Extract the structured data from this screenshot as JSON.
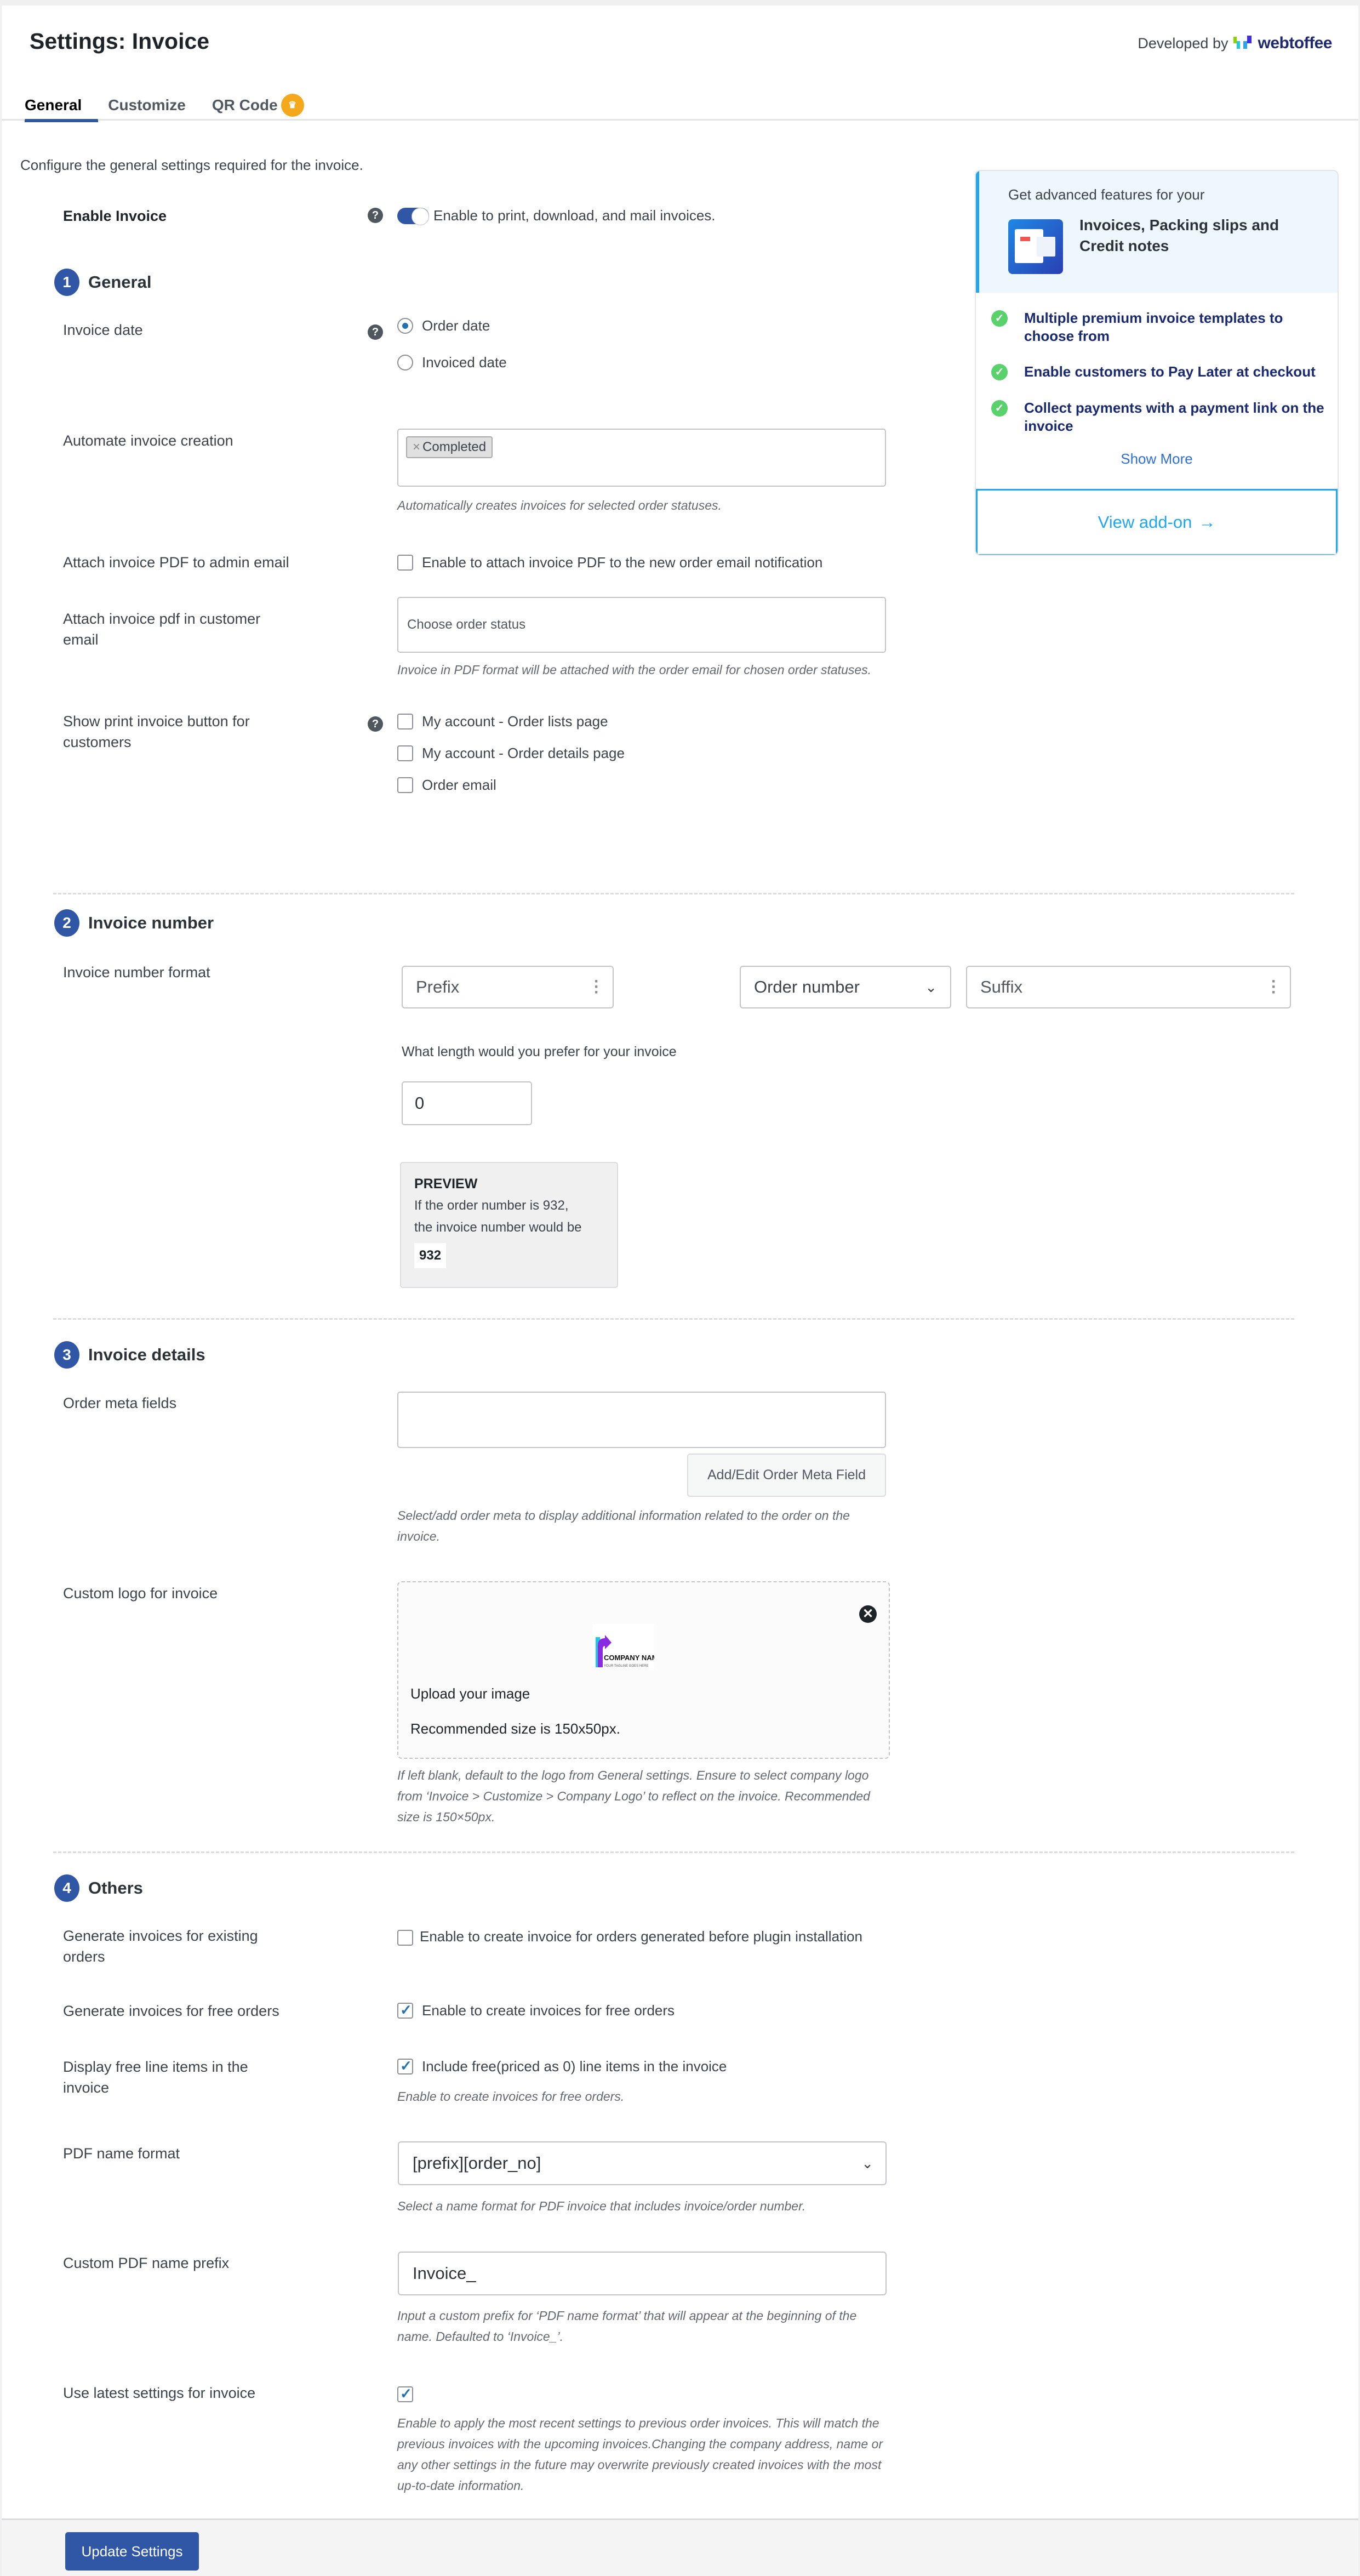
{
  "header": {
    "title": "Settings: Invoice",
    "developed_by": "Developed by",
    "brand": "webtoffee"
  },
  "tabs": [
    {
      "label": "General",
      "active": true
    },
    {
      "label": "Customize",
      "active": false
    },
    {
      "label": "QR Code",
      "active": false,
      "badge_icon": "crown-icon"
    }
  ],
  "intro": "Configure the general settings required for the invoice.",
  "enable_invoice": {
    "label": "Enable Invoice",
    "enabled": true,
    "text": "Enable to print, download, and mail invoices."
  },
  "sections": {
    "general": {
      "number": "1",
      "title": "General"
    },
    "invoice_number": {
      "number": "2",
      "title": "Invoice number"
    },
    "invoice_details": {
      "number": "3",
      "title": "Invoice details"
    },
    "others": {
      "number": "4",
      "title": "Others"
    }
  },
  "invoice_date": {
    "label": "Invoice date",
    "options": [
      {
        "label": "Order date",
        "selected": true
      },
      {
        "label": "Invoiced date",
        "selected": false
      }
    ]
  },
  "automate_creation": {
    "label": "Automate invoice creation",
    "tags": [
      "Completed"
    ],
    "tag_remove": "×",
    "desc": "Automatically creates invoices for selected order statuses."
  },
  "attach_admin": {
    "label": "Attach invoice PDF to admin email",
    "checked": false,
    "text": "Enable to attach invoice PDF to the new order email notification"
  },
  "attach_customer": {
    "label": "Attach invoice pdf in customer email",
    "placeholder": "Choose order status",
    "desc": "Invoice in PDF format will be attached with the order email for chosen order statuses."
  },
  "print_button": {
    "label": "Show print invoice button for customers",
    "options": [
      {
        "label": "My account - Order lists page",
        "checked": false
      },
      {
        "label": "My account - Order details page",
        "checked": false
      },
      {
        "label": "Order email",
        "checked": false
      }
    ]
  },
  "number_format": {
    "label": "Invoice number format",
    "prefix_placeholder": "Prefix",
    "base_value": "Order number",
    "suffix_placeholder": "Suffix",
    "length_label": "What length would you prefer for your invoice",
    "length_value": "0",
    "preview": {
      "title": "PREVIEW",
      "line1": "If the order number is 932,",
      "line2": "the invoice number would be",
      "value": "932"
    }
  },
  "order_meta": {
    "label": "Order meta fields",
    "button": "Add/Edit Order Meta Field",
    "desc": "Select/add order meta to display additional information related to the order on the invoice."
  },
  "custom_logo": {
    "label": "Custom logo for invoice",
    "logo_name": "COMPANY NAME",
    "logo_tagline": "YOUR TAGLINE GOES HERE",
    "upload_text": "Upload your image",
    "size_text": "Recommended size is 150x50px.",
    "desc": "If left blank, default to the logo from General settings. Ensure to select company logo from ‘Invoice > Customize > Company Logo’ to reflect on the invoice. Recommended size is 150×50px."
  },
  "existing_orders": {
    "label": "Generate invoices for existing orders",
    "checked": false,
    "text": "Enable to create invoice for orders generated before plugin installation"
  },
  "free_orders": {
    "label": "Generate invoices for free orders",
    "checked": true,
    "text": "Enable to create invoices for free orders"
  },
  "free_line_items": {
    "label": "Display free line items in the invoice",
    "checked": true,
    "text": "Include free(priced as 0) line items in the invoice",
    "desc": "Enable to create invoices for free orders."
  },
  "pdf_name_format": {
    "label": "PDF name format",
    "value": "[prefix][order_no]",
    "desc": "Select a name format for PDF invoice that includes invoice/order number."
  },
  "pdf_name_prefix": {
    "label": "Custom PDF name prefix",
    "value": "Invoice_",
    "desc": "Input a custom prefix for ‘PDF name format’ that will appear at the beginning of the name. Defaulted to ‘Invoice_’."
  },
  "latest_settings": {
    "label": "Use latest settings for invoice",
    "checked": true,
    "desc": "Enable to apply the most recent settings to previous order invoices. This will match the previous invoices with the upcoming invoices.Changing the company address, name or any other settings in the future may overwrite previously created invoices with the most up-to-date information."
  },
  "footer": {
    "update_button": "Update Settings"
  },
  "promo": {
    "subtitle": "Get advanced features for your",
    "product": "Invoices, Packing slips and Credit notes",
    "features": [
      "Multiple premium invoice templates to choose from",
      "Enable customers to Pay Later at checkout",
      "Collect payments with a payment link on the invoice"
    ],
    "show_more": "Show More",
    "cta": "View add-on",
    "cta_arrow": "→"
  },
  "colors": {
    "primary": "#3056a6",
    "promo_accent": "#1ea7f0",
    "check_green": "#5ad26b",
    "crown": "#f4a81c"
  }
}
